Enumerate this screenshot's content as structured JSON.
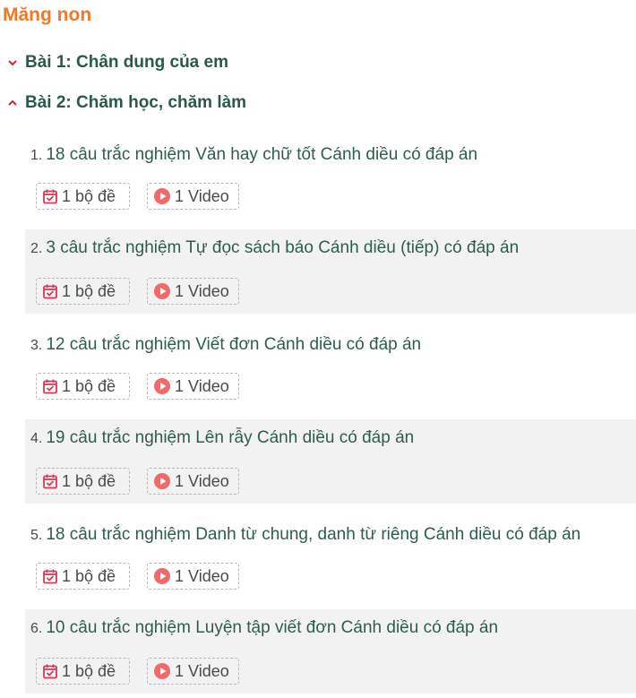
{
  "section": {
    "title": "Măng non"
  },
  "lessons": [
    {
      "label": "Bài 1: Chân dung của em",
      "expanded": false
    },
    {
      "label": "Bài 2: Chăm học, chăm làm",
      "expanded": true
    }
  ],
  "items": [
    {
      "number": "1.",
      "title": "18 câu trắc nghiệm Văn hay chữ tốt Cánh diều có đáp án",
      "quiz": "1 bộ đề",
      "video": "1 Video"
    },
    {
      "number": "2.",
      "title": "3 câu trắc nghiệm Tự đọc sách báo Cánh diều (tiếp) có đáp án",
      "quiz": "1 bộ đề",
      "video": "1 Video"
    },
    {
      "number": "3.",
      "title": "12 câu trắc nghiệm Viết đơn Cánh diều có đáp án",
      "quiz": "1 bộ đề",
      "video": "1 Video"
    },
    {
      "number": "4.",
      "title": "19 câu trắc nghiệm Lên rẫy Cánh diều có đáp án",
      "quiz": "1 bộ đề",
      "video": "1 Video"
    },
    {
      "number": "5.",
      "title": "18 câu trắc nghiệm Danh từ chung, danh từ riêng Cánh diều có đáp án",
      "quiz": "1 bộ đề",
      "video": "1 Video"
    },
    {
      "number": "6.",
      "title": "10 câu trắc nghiệm Luyện tập viết đơn Cánh diều có đáp án",
      "quiz": "1 bộ đề",
      "video": "1 Video"
    }
  ],
  "icons": {
    "chevron_collapsed": "chevron-down-icon",
    "chevron_expanded": "chevron-up-icon",
    "quiz": "calendar-check-icon",
    "video": "play-circle-icon"
  },
  "colors": {
    "section_title": "#f07828",
    "lesson_text": "#2a5a46",
    "item_text": "#2f5d4b",
    "chevron": "#d0243a",
    "quiz_icon": "#d63a5a",
    "video_icon": "#f06a6a",
    "shaded_row": "#f2f2f2"
  }
}
